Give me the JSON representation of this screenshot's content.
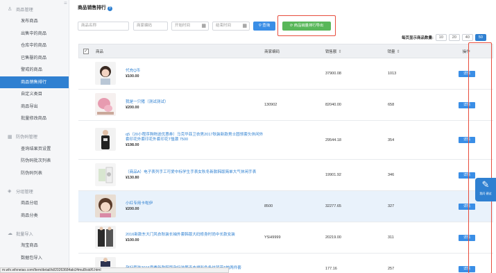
{
  "sidebar": {
    "groups": [
      {
        "title": "商品管理",
        "icon": "user-icon",
        "items": [
          "发布商品",
          "出售中的商品",
          "仓库中的商品",
          "已售罄的商品",
          "警戒的商品",
          "商品销售排行",
          "自定义类目",
          "商品导出",
          "批量修改商品"
        ]
      },
      {
        "title": "防伪码管理",
        "icon": "grid-icon",
        "items": [
          "查询结果页设置",
          "防伪码批次列表",
          "防伪码列表"
        ]
      },
      {
        "title": "分组管理",
        "icon": "tag-icon",
        "items": [
          "商品分组",
          "商品分类"
        ]
      },
      {
        "title": "批量导入",
        "icon": "cloud-icon",
        "items": [
          "淘宝商品",
          "数据包导入"
        ]
      }
    ],
    "active_item": "商品销售排行"
  },
  "page": {
    "title": "商品销售排行",
    "help_icon": "?"
  },
  "filters": {
    "name_placeholder": "商品名称",
    "code_placeholder": "商家编码",
    "start_placeholder": "开始时间",
    "end_placeholder": "结束时间",
    "search_label": "查询",
    "export_label": "商品销量排行导出"
  },
  "pagesize": {
    "label": "每页显示商品数量:",
    "options": [
      "10",
      "20",
      "40",
      "50"
    ],
    "selected": "50"
  },
  "table": {
    "headers": {
      "product": "商品",
      "code": "商家编码",
      "sales": "销售额",
      "qty": "销量",
      "op": "操作"
    },
    "detail_label": "详情",
    "rows": [
      {
        "name": "代充Q币",
        "price": "¥100.00",
        "code": "",
        "sales": "37900.08",
        "qty": "1013"
      },
      {
        "name": "我是一只猪（测试测试）",
        "price": "¥200.00",
        "code": "130902",
        "sales": "82040.00",
        "qty": "658"
      },
      {
        "name": "q5（20小程序购物送优惠券）马克华菲卫衣男2017秋装新款男士圆领套头休闲外套印花外套印花外套印花T恤潮 7500",
        "price": "¥198.00",
        "code": "",
        "sales": "29544.18",
        "qty": "354"
      },
      {
        "name": "（商品A）电子表列手工可爱中标学生手表女秋冬新款韩版简单大气休闲手表",
        "price": "¥130.80",
        "code": "",
        "sales": "19901.92",
        "qty": "346"
      },
      {
        "name": "小红专用卡啦伊",
        "price": "¥200.00",
        "code": "8500",
        "sales": "32277.65",
        "qty": "327"
      },
      {
        "name": "2016新款东大门风衣秋装长袖外套韩版大码修身时尚中长款女装",
        "price": "¥100.00",
        "code": "YSH9999",
        "sales": "20219.00",
        "qty": "311"
      },
      {
        "name": "孕妇套装2016夏季新款韩版孕妇装等连衣裙彩色条纹背带T恤两件套",
        "price": "",
        "code": "",
        "sales": "177.16",
        "qty": "257"
      }
    ]
  },
  "float_button": {
    "icon": "edit-icon",
    "label": "我问·建议"
  },
  "status_url": "m.wfx.wfxneiao.com/Item/detail/id/20263684akiJ4mu8/sid/6.html",
  "colors": {
    "primary": "#2f80d1",
    "export_green": "#58b759",
    "highlight_red": "#e74c3c"
  }
}
